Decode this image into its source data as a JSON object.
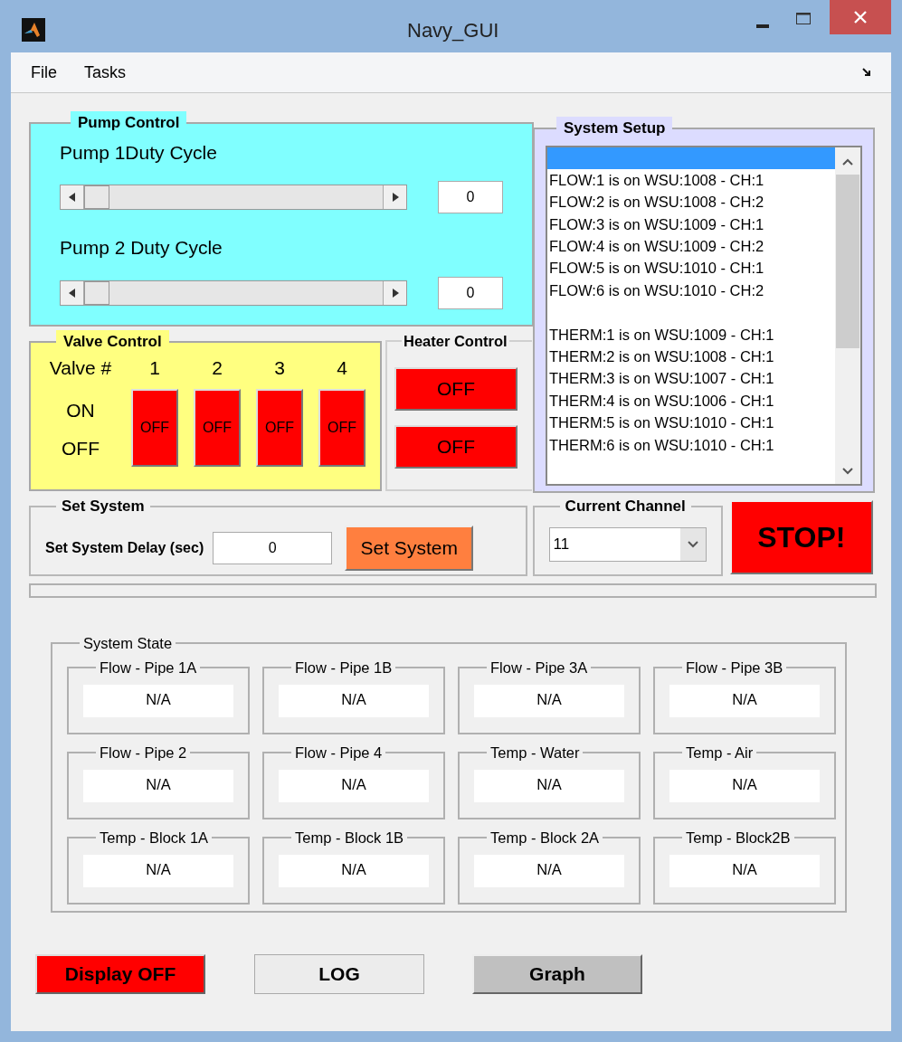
{
  "window": {
    "title": "Navy_GUI"
  },
  "menu": [
    "File",
    "Tasks"
  ],
  "pump_control": {
    "title": "Pump Control",
    "pumps": [
      {
        "label": "Pump 1Duty Cycle",
        "value": "0"
      },
      {
        "label": "Pump 2 Duty Cycle",
        "value": "0"
      }
    ]
  },
  "valve_control": {
    "title": "Valve Control",
    "header_label": "Valve #",
    "on_label": "ON",
    "off_label": "OFF",
    "valves": [
      {
        "number": "1",
        "label": "OFF",
        "on": false
      },
      {
        "number": "2",
        "label": "OFF",
        "on": false
      },
      {
        "number": "3",
        "label": "OFF",
        "on": false
      },
      {
        "number": "4",
        "label": "OFF",
        "on": false
      }
    ]
  },
  "heater_control": {
    "title": "Heater Control",
    "heaters": [
      {
        "label": "OFF",
        "on": false
      },
      {
        "label": "OFF",
        "on": false
      }
    ]
  },
  "system_setup": {
    "title": "System Setup",
    "items": [
      {
        "kind": "blank",
        "selected": true
      },
      {
        "kind": "entry",
        "text": "FLOW:1 is on WSU:1008 - CH:1",
        "selected": false
      },
      {
        "kind": "entry",
        "text": "FLOW:2 is on WSU:1008 - CH:2",
        "selected": false
      },
      {
        "kind": "entry",
        "text": "FLOW:3 is on WSU:1009 - CH:1",
        "selected": false
      },
      {
        "kind": "entry",
        "text": "FLOW:4 is on WSU:1009 - CH:2",
        "selected": false
      },
      {
        "kind": "entry",
        "text": "FLOW:5 is on WSU:1010 - CH:1",
        "selected": false
      },
      {
        "kind": "entry",
        "text": "FLOW:6 is on WSU:1010 - CH:2",
        "selected": false
      },
      {
        "kind": "entry",
        "text": "THERM:1 is on WSU:1009 - CH:1",
        "selected": false,
        "gap_before": true
      },
      {
        "kind": "entry",
        "text": "THERM:2 is on WSU:1008 - CH:1",
        "selected": false
      },
      {
        "kind": "entry",
        "text": "THERM:3 is on WSU:1007 - CH:1",
        "selected": false
      },
      {
        "kind": "entry",
        "text": "THERM:4 is on WSU:1006 - CH:1",
        "selected": false
      },
      {
        "kind": "entry",
        "text": "THERM:5 is on WSU:1010 - CH:1",
        "selected": false
      },
      {
        "kind": "entry",
        "text": "THERM:6 is on WSU:1010 - CH:1",
        "selected": false
      }
    ]
  },
  "set_system": {
    "title": "Set System",
    "delay_label": "Set System Delay (sec)",
    "delay_value": "0",
    "button": "Set System"
  },
  "current_channel": {
    "title": "Current Channel",
    "value": "11"
  },
  "stop_button": "STOP!",
  "system_state": {
    "title": "System State",
    "readouts": [
      {
        "label": "Flow - Pipe 1A",
        "value": "N/A"
      },
      {
        "label": "Flow - Pipe 1B",
        "value": "N/A"
      },
      {
        "label": "Flow - Pipe 3A",
        "value": "N/A"
      },
      {
        "label": "Flow - Pipe 3B",
        "value": "N/A"
      },
      {
        "label": "Flow - Pipe 2",
        "value": "N/A"
      },
      {
        "label": "Flow - Pipe 4",
        "value": "N/A"
      },
      {
        "label": "Temp - Water",
        "value": "N/A"
      },
      {
        "label": "Temp - Air",
        "value": "N/A"
      },
      {
        "label": "Temp - Block 1A",
        "value": "N/A"
      },
      {
        "label": "Temp - Block 1B",
        "value": "N/A"
      },
      {
        "label": "Temp - Block 2A",
        "value": "N/A"
      },
      {
        "label": "Temp - Block2B",
        "value": "N/A"
      }
    ]
  },
  "buttons": [
    {
      "label": "Display OFF",
      "kind": "alert"
    },
    {
      "label": "LOG",
      "kind": "flat"
    },
    {
      "label": "Graph",
      "kind": "raised"
    }
  ]
}
